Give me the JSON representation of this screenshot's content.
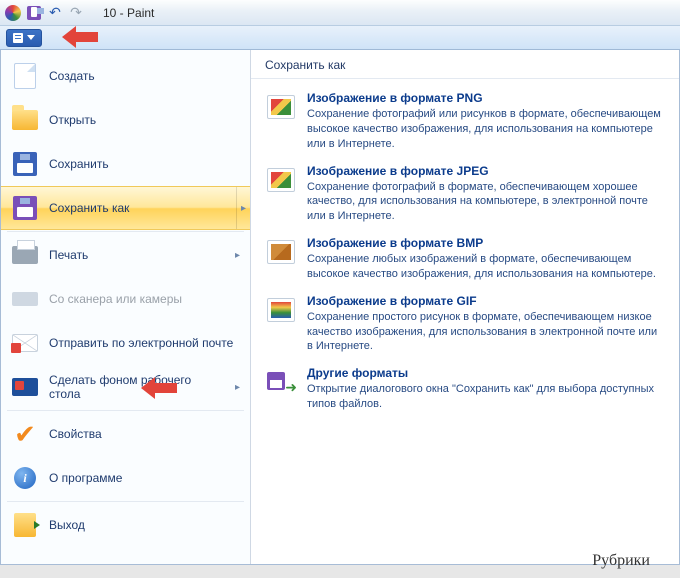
{
  "titlebar": {
    "title": "10 - Paint"
  },
  "menu": {
    "items": [
      {
        "label": "Создать",
        "icon": "new-doc-icon",
        "disabled": false,
        "submenu": false
      },
      {
        "label": "Открыть",
        "icon": "open-icon",
        "disabled": false,
        "submenu": false
      },
      {
        "label": "Сохранить",
        "icon": "save-icon",
        "disabled": false,
        "submenu": false
      },
      {
        "label": "Сохранить как",
        "icon": "save-as-icon",
        "disabled": false,
        "submenu": true,
        "highlight": true
      },
      {
        "label": "Печать",
        "icon": "print-icon",
        "disabled": false,
        "submenu": true
      },
      {
        "label": "Со сканера или камеры",
        "icon": "scanner-icon",
        "disabled": true,
        "submenu": false
      },
      {
        "label": "Отправить по электронной почте",
        "icon": "email-icon",
        "disabled": false,
        "submenu": false
      },
      {
        "label": "Сделать фоном рабочего стола",
        "icon": "desktop-bg-icon",
        "disabled": false,
        "submenu": true
      },
      {
        "label": "Свойства",
        "icon": "properties-icon",
        "disabled": false,
        "submenu": false
      },
      {
        "label": "О программе",
        "icon": "about-icon",
        "disabled": false,
        "submenu": false
      },
      {
        "label": "Выход",
        "icon": "exit-icon",
        "disabled": false,
        "submenu": false
      }
    ]
  },
  "right": {
    "header": "Сохранить как",
    "items": [
      {
        "title": "Изображение в формате PNG",
        "desc": "Сохранение фотографий или рисунков в формате, обеспечивающем высокое качество изображения, для использования на компьютере или в Интернете.",
        "icon": "png-icon"
      },
      {
        "title": "Изображение в формате JPEG",
        "desc": "Сохранение фотографий в формате, обеспечивающем хорошее качество, для использования на компьютере, в электронной почте или в Интернете.",
        "icon": "jpeg-icon"
      },
      {
        "title": "Изображение в формате BMP",
        "desc": "Сохранение любых изображений в формате, обеспечивающем высокое качество изображения, для использования на компьютере.",
        "icon": "bmp-icon"
      },
      {
        "title": "Изображение в формате GIF",
        "desc": "Сохранение простого рисунок в формате, обеспечивающем низкое качество изображения, для использования в электронной почте или в Интернете.",
        "icon": "gif-icon"
      },
      {
        "title": "Другие форматы",
        "desc": "Открытие диалогового окна \"Сохранить как\" для выбора доступных типов файлов.",
        "icon": "other-format-icon"
      }
    ]
  },
  "footer": {
    "text": "Рубрики"
  }
}
